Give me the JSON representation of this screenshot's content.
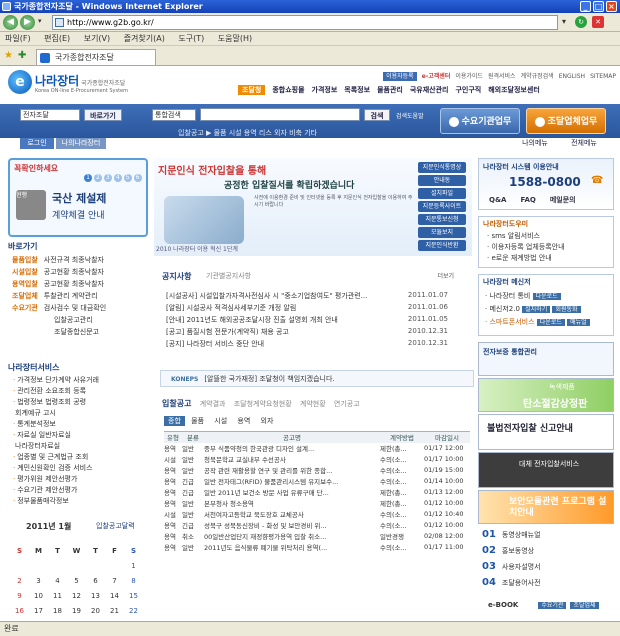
{
  "window": {
    "title": "국가종합전자조달 - Windows Internet Explorer",
    "minimize": "_",
    "maximize": "□",
    "close": "×"
  },
  "address": {
    "url": "http://www.g2b.go.kr/"
  },
  "menu": [
    "파일(F)",
    "편집(E)",
    "보기(V)",
    "즐겨찾기(A)",
    "도구(T)",
    "도움말(H)"
  ],
  "tab": {
    "title": "국가종합전자조달"
  },
  "status": "완료",
  "site": {
    "logo_mark": "e",
    "name": "나라장터",
    "name_sub": "국가종합전자조달",
    "name_en": "Korea ON-line E-Procurement System",
    "top_links": [
      "이용자등록",
      "e-고객센터",
      "이용가이드",
      "원격서비스",
      "계약규정검색",
      "ENGLISH",
      "SITEMAP"
    ],
    "gnb": [
      "조달청",
      "종합쇼핑몰",
      "가격정보",
      "목록정보",
      "물품관리",
      "국유재산관리",
      "구인구직",
      "해외조달정보센터"
    ]
  },
  "search": {
    "scope": "전자조달",
    "scope_btn": "바로가기",
    "type": "통합검색",
    "btn": "검색",
    "detail": "검색도움말",
    "ticker": "입찰공고 ▶ 물품 시설 용역 리스 외자 비축 기타",
    "tab_agency": "수요기관업무",
    "tab_company": "조달업체업무"
  },
  "login": {
    "login": "로그인",
    "mine": "나의나라장터",
    "mine_right": "나의메뉴",
    "all_right": "전체메뉴"
  },
  "promo": {
    "head": "꼭확인하세요",
    "pages": [
      "1",
      "2",
      "3",
      "4",
      "5",
      "6"
    ],
    "title": "국산 제설제",
    "sub": "계약체결 안내",
    "tag": "현행"
  },
  "banner": {
    "headline": "지문인식 전자입찰을 통해",
    "headline2": "공정한 입찰질서를 확립하겠습니다",
    "small": "사전에 이용환경 준비 및 인터넷을 등록 후 지문인식 전자입찰을 이용하여 주시기 바랍니다",
    "caption": "2010 나라장터 이용 혁신 1단계",
    "menu": [
      "지문인식통명상",
      "안내동",
      "설치파일",
      "지문등록사이트",
      "지문통보신청",
      "모듈보지",
      "지문인식반환"
    ]
  },
  "quick": {
    "head": "바로가기",
    "rows": [
      {
        "k": "물품입찰",
        "v": "사전규격  최종낙찰자"
      },
      {
        "k": "시설입찰",
        "v": "공고현황  최종낙찰자"
      },
      {
        "k": "용역입찰",
        "v": "공고현황  최종낙찰자"
      },
      {
        "k": "조달업체",
        "v": "투찰관리  계약관리"
      },
      {
        "k": "수요기관",
        "v": "검사검수 및 대금확인"
      },
      {
        "k": "",
        "v": "입찰공고관리"
      },
      {
        "k": "",
        "v": "조달종합신문고"
      }
    ]
  },
  "notice": {
    "tab1": "공지사항",
    "tab2": "기관별공지사항",
    "more": "더보기",
    "items": [
      {
        "t": "[시설공사] 시설입찰가자격사전심사 시 \"중소기업참여도\" 평가관련...",
        "d": "2011.01.07"
      },
      {
        "t": "[알림] 시설공사 적격심사세부기준 개정 알림",
        "d": "2011.01.06"
      },
      {
        "t": "[안내] 2011년도 해외공공조달시장 진출 설명회 개최 안내",
        "d": "2011.01.05"
      },
      {
        "t": "[공고] 품질시험 전문가(계약직) 채용 공고",
        "d": "2010.12.31"
      },
      {
        "t": "[공지] 나라장터 서비스 중단 안내",
        "d": "2010.12.31"
      }
    ]
  },
  "koneps": {
    "label": "KONEPS",
    "msg": "[알뜰한 국가재정] 조달청이 책임지겠습니다."
  },
  "bid": {
    "tabs": [
      "입찰공고",
      "계약결과",
      "조달청계약요청현황",
      "계약현황",
      "연기공고"
    ],
    "subtabs": [
      "종합",
      "물품",
      "시설",
      "용역",
      "외자"
    ],
    "headers": [
      "유형",
      "분류",
      "공고명",
      "계약방법",
      "마감일시"
    ],
    "rows": [
      [
        "용역",
        "일반",
        "중부 식품약청의 한국관광 디자인 설계...",
        "제한(총...",
        "01/17 12:00"
      ],
      [
        "시설",
        "일반",
        "청북문학교 교실내부 수선공사",
        "수의(소...",
        "01/17 10:00"
      ],
      [
        "용역",
        "일반",
        "공작 관련 재활용할 연구 및 관리를 위한 종합...",
        "수의(소...",
        "01/19 15:00"
      ],
      [
        "용역",
        "긴급",
        "일반 전자태그(RFID) 물품관리시스템 유지보수...",
        "수의(소...",
        "01/14 10:00"
      ],
      [
        "용역",
        "긴급",
        "일반 2011년 보건소 방문 사업 유류구매 단...",
        "제한(총...",
        "01/13 12:00"
      ],
      [
        "용역",
        "일반",
        "본부청사 청소용역",
        "제한(총...",
        "01/12 10:00"
      ],
      [
        "시설",
        "일반",
        "서천여자고등학교 북도장호 교체공사",
        "수의(소...",
        "01/12 10:40"
      ],
      [
        "용역",
        "긴급",
        "성북구 성북동신장비 - 화성 및 보안경비 위...",
        "수의(소...",
        "01/12 10:00"
      ],
      [
        "용역",
        "취소",
        "00일반산업단지 재정향평가용역 입찰 취소...",
        "일반경쟁",
        "02/08 12:00"
      ],
      [
        "용역",
        "일반",
        "2011년도 음식물류 폐기물 위탁처리 용역(...",
        "수의(소...",
        "01/17 11:00"
      ]
    ]
  },
  "services": {
    "head": "나라장터서비스",
    "items": [
      "가격정보  단가계약  사유거래",
      "관리전환  소요조회  등록",
      "법령정보  법령조회  공령",
      "         회계예규  고시",
      "통계분석정보",
      "자료실   일반자료실",
      "         나라장터자료실",
      "업종별 및 근계법규 조회",
      "계민신원확인 검증 서비스",
      "평가위원 제안선평가",
      "수요기관 제안선평가",
      "정부물품매각정보"
    ]
  },
  "calendar": {
    "month": "2011년 1월",
    "title": "입찰공고달력",
    "days": [
      "S",
      "M",
      "T",
      "W",
      "T",
      "F",
      "S"
    ],
    "weeks": [
      [
        "",
        "",
        "",
        "",
        "",
        "",
        "1"
      ],
      [
        "2",
        "3",
        "4",
        "5",
        "6",
        "7",
        "8"
      ],
      [
        "9",
        "10",
        "11",
        "12",
        "13",
        "14",
        "15"
      ],
      [
        "16",
        "17",
        "18",
        "19",
        "20",
        "21",
        "22"
      ],
      [
        "23",
        "24",
        "25",
        "26",
        "27",
        "28",
        "29"
      ]
    ]
  },
  "right": {
    "center_title": "나라장터 시스템 이용안내",
    "phone": "1588-0800",
    "qa": [
      "Q&A",
      "FAQ",
      "메일문의"
    ],
    "helper_title": "나라장터도우미",
    "helper": [
      "sms 알림서비스",
      "이용자등록  업체등록안내",
      "e로운 재계방법 안내"
    ],
    "messenger_title": "나라장터 메신저",
    "messenger": [
      {
        "t": "나라장터 통비",
        "b": [
          "다운로드"
        ]
      },
      {
        "t": "메신저2.0",
        "b": [
          "설치하기",
          "회원통화"
        ]
      },
      {
        "t": "스마트폰서비스",
        "b": [
          "다운로드",
          "매뉴얼"
        ]
      }
    ],
    "ads": [
      "전자보증 통합관리",
      "녹색제품",
      "탄소절감상정판",
      "불법전자입찰 신고안내",
      "대체 전자입찰서비스",
      "보안모듈관련 프로그램 설치안내"
    ],
    "numbered": [
      {
        "n": "01",
        "t": "동영상매뉴얼"
      },
      {
        "n": "02",
        "t": "홍보동영상"
      },
      {
        "n": "03",
        "t": "사용자설명서"
      },
      {
        "n": "04",
        "t": "조달용어사전"
      }
    ],
    "ebook": "e-BOOK",
    "ebook_btns": [
      "수요기관",
      "조달업체"
    ]
  }
}
